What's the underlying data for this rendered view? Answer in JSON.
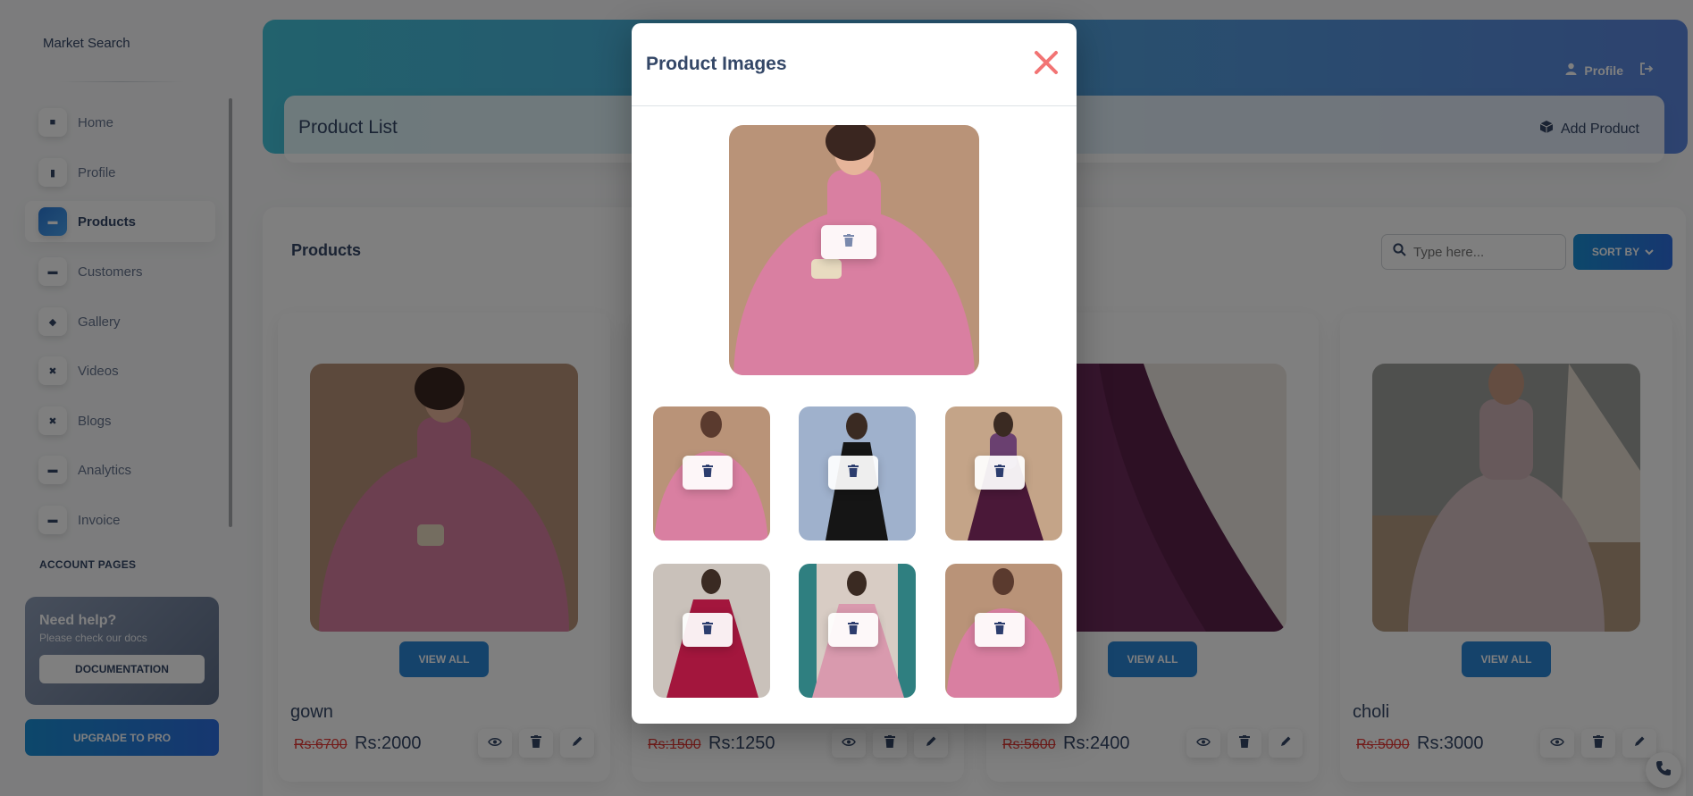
{
  "sidebar": {
    "brand": "Market Search",
    "items": [
      {
        "label": "Home",
        "icon": "home-icon",
        "active": false
      },
      {
        "label": "Profile",
        "icon": "chart-icon",
        "active": false
      },
      {
        "label": "Products",
        "icon": "card-icon",
        "active": true
      },
      {
        "label": "Customers",
        "icon": "card-icon",
        "active": false
      },
      {
        "label": "Gallery",
        "icon": "box-icon",
        "active": false
      },
      {
        "label": "Videos",
        "icon": "tools-icon",
        "active": false
      },
      {
        "label": "Blogs",
        "icon": "tools-icon",
        "active": false
      },
      {
        "label": "Analytics",
        "icon": "card-icon",
        "active": false
      },
      {
        "label": "Invoice",
        "icon": "card-icon",
        "active": false
      }
    ],
    "section_title": "ACCOUNT PAGES",
    "help": {
      "title": "Need help?",
      "subtitle": "Please check our docs",
      "button": "DOCUMENTATION"
    },
    "upgrade": "UPGRADE TO PRO"
  },
  "header": {
    "profile_link": "Profile",
    "page_title": "Product List",
    "add_product": "Add Product"
  },
  "products": {
    "title": "Products",
    "search_placeholder": "Type here...",
    "sort_label": "SORT BY",
    "view_all": "VIEW ALL",
    "items": [
      {
        "name": "gown",
        "old_price": "Rs:6700",
        "price": "Rs:2000"
      },
      {
        "name": "",
        "old_price": "Rs:1500",
        "price": "Rs:1250"
      },
      {
        "name": "",
        "old_price": "Rs:5600",
        "price": "Rs:2400"
      },
      {
        "name": "choli",
        "old_price": "Rs:5000",
        "price": "Rs:3000"
      }
    ]
  },
  "modal": {
    "title": "Product Images",
    "thumbnails_count": 6
  },
  "colors": {
    "accent": "#2b86d6",
    "close": "#f27474",
    "strike_price": "#e53935",
    "text": "#344767"
  }
}
